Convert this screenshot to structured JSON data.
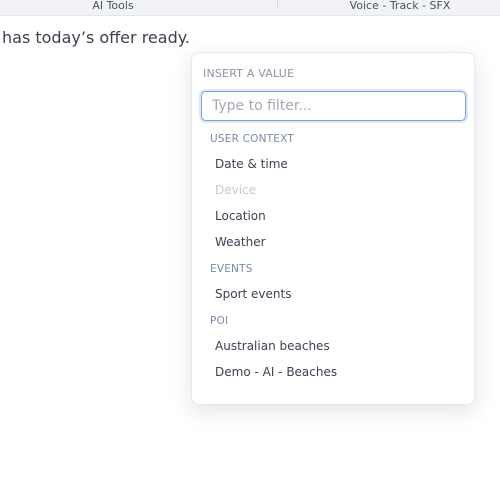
{
  "topbar": {
    "tab_left": "AI Tools",
    "tab_right": "Voice - Track - SFX"
  },
  "content": {
    "text": "has today’s offer ready."
  },
  "dropdown": {
    "header": "INSERT A VALUE",
    "filter_placeholder": "Type to filter...",
    "groups": [
      {
        "label": "USER CONTEXT",
        "items": [
          {
            "label": "Date & time",
            "disabled": false
          },
          {
            "label": "Device",
            "disabled": true
          },
          {
            "label": "Location",
            "disabled": false
          },
          {
            "label": "Weather",
            "disabled": false
          }
        ]
      },
      {
        "label": "EVENTS",
        "items": [
          {
            "label": "Sport events",
            "disabled": false
          }
        ]
      },
      {
        "label": "POI",
        "items": [
          {
            "label": "Australian beaches",
            "disabled": false
          },
          {
            "label": "Demo - AI - Beaches",
            "disabled": false
          }
        ]
      }
    ]
  }
}
